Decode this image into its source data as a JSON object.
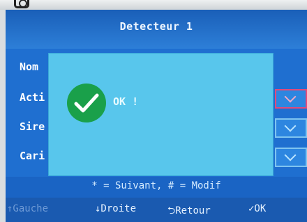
{
  "screen": {
    "title": "Detecteur 1",
    "menu_items": [
      {
        "label": "Nom"
      },
      {
        "label": "Acti"
      },
      {
        "label": "Sire"
      },
      {
        "label": "Cari"
      }
    ],
    "popup": {
      "icon": "check-circle-icon",
      "message": "OK !"
    },
    "help": "* = Suivant, # = Modif",
    "nav": {
      "left": "↑Gauche",
      "down": "↓Droite",
      "back": "⮌Retour",
      "ok": "✓OK"
    }
  },
  "colors": {
    "screen_bg": "#1f6fd0",
    "popup_bg": "#58c6ec",
    "ok_green": "#1aa04a"
  }
}
